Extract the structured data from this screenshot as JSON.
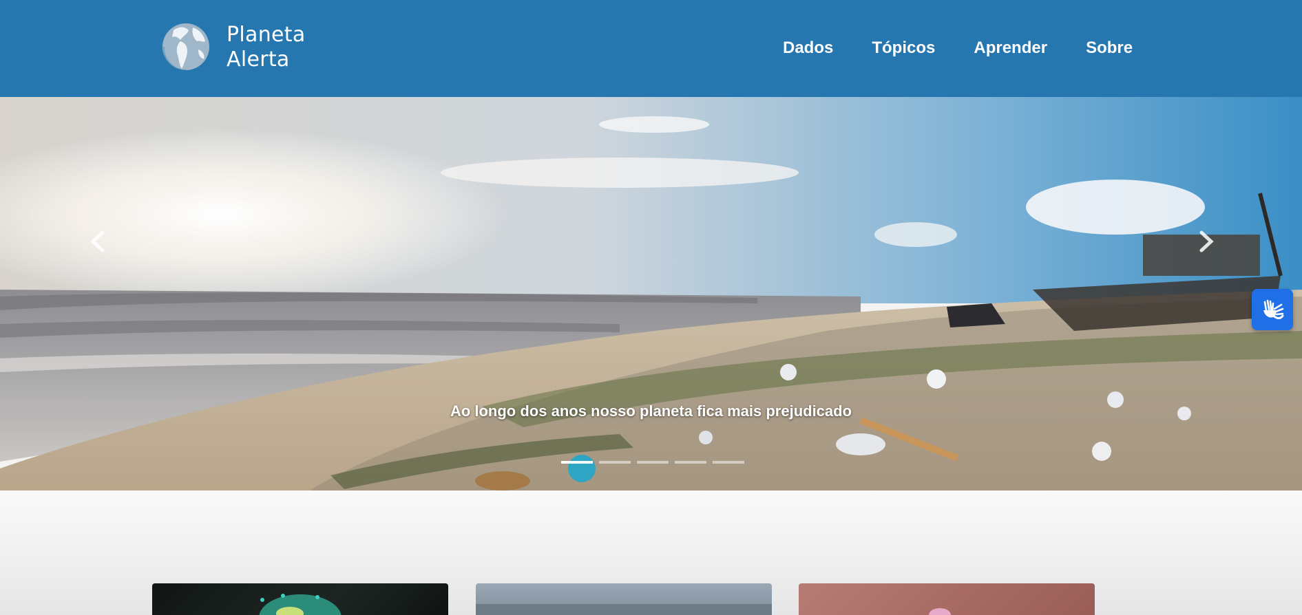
{
  "header": {
    "brand_line1": "Planeta",
    "brand_line2": "Alerta",
    "logo_icon": "globe-icon",
    "nav": [
      {
        "label": "Dados"
      },
      {
        "label": "Tópicos"
      },
      {
        "label": "Aprender"
      },
      {
        "label": "Sobre"
      }
    ],
    "background": "#2676b0"
  },
  "carousel": {
    "caption": "Ao longo dos anos nosso planeta fica mais prejudicado",
    "slide_count": 5,
    "active_slide": 1,
    "prev_icon": "chevron-left-icon",
    "next_icon": "chevron-right-icon"
  },
  "accessibility": {
    "icon": "sign-language-hands-icon",
    "color": "#1f6fe6"
  },
  "cards": [
    {
      "icon": "earth-image"
    },
    {
      "icon": "landscape-image"
    },
    {
      "icon": "animal-image"
    }
  ]
}
